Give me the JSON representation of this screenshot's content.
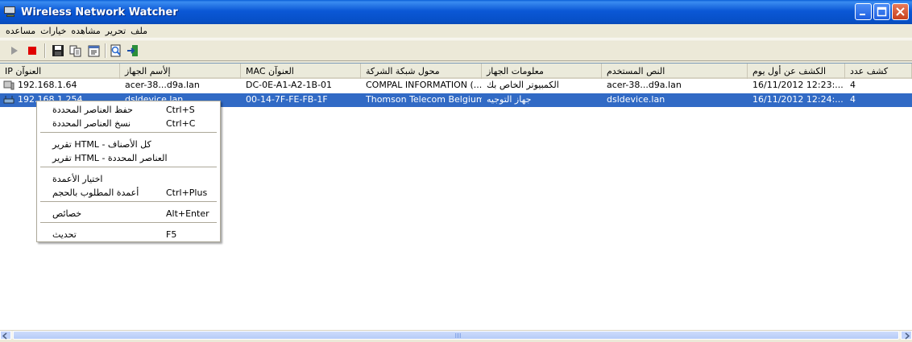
{
  "window": {
    "title": "Wireless Network Watcher"
  },
  "menu": [
    "ملف",
    "تحرير",
    "مشاهده",
    "خيارات",
    "مساعده"
  ],
  "toolbar": {
    "buttons": [
      "play-icon",
      "stop-icon",
      "save-icon",
      "copy-icon",
      "properties-icon",
      "html-report-icon",
      "exit-icon"
    ]
  },
  "columns": [
    "العنوآن IP",
    "إلأسم الجهاز",
    "MAC العنوآن",
    "محول شبكة الشركة",
    "معلومات الجهاز",
    "النص المستخدم",
    "الكشف عن أول يوم",
    "كشف عدد"
  ],
  "rows": [
    {
      "ip": "192.168.1.64",
      "device_name": "acer-38...d9a.lan",
      "mac": "DC-0E-A1-A2-1B-01",
      "adapter": "COMPAL INFORMATION (...",
      "device_info": "الكمبيوتر الخاص بك",
      "user_text": "acer-38...d9a.lan",
      "first_detected": "16/11/2012 12:23:...",
      "count": "4",
      "selected": false
    },
    {
      "ip": "192.168.1.254",
      "device_name": "dsldevice.lan",
      "mac": "00-14-7F-FE-FB-1F",
      "adapter": "Thomson Telecom Belgium",
      "device_info": "جهاز التوجيه",
      "user_text": "dsldevice.lan",
      "first_detected": "16/11/2012 12:24:...",
      "count": "4",
      "selected": true
    }
  ],
  "context_menu": {
    "items": [
      {
        "label": "حفظ العناصر المحددة",
        "shortcut": "Ctrl+S"
      },
      {
        "label": "نسخ العناصر المحددة",
        "shortcut": "Ctrl+C"
      },
      {
        "label": "كل الأصناف - HTML تقرير",
        "shortcut": ""
      },
      {
        "label": "العناصر المحددة - HTML تقرير",
        "shortcut": ""
      },
      {
        "label": "اختيار الأعمدة",
        "shortcut": ""
      },
      {
        "label": "أعمدة المطلوب بالحجم",
        "shortcut": "Ctrl+Plus"
      },
      {
        "label": "خصائص",
        "shortcut": "Alt+Enter"
      },
      {
        "label": "تحديث",
        "shortcut": "F5"
      }
    ]
  }
}
